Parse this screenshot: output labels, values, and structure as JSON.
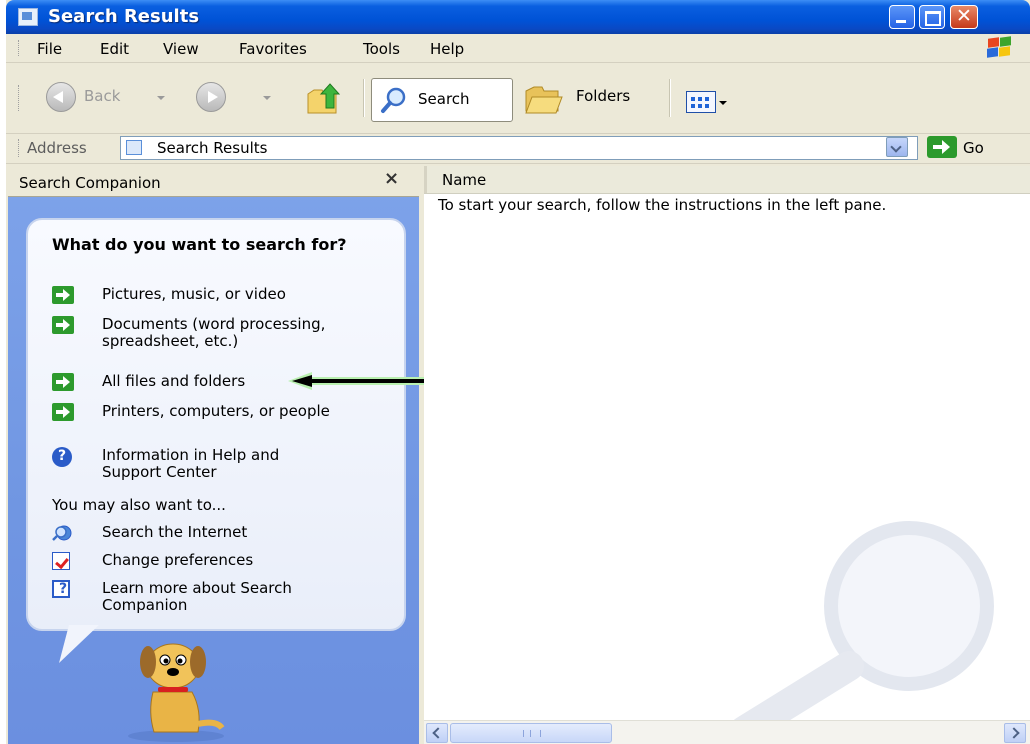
{
  "window": {
    "title": "Search Results"
  },
  "menu": [
    "File",
    "Edit",
    "View",
    "Favorites",
    "Tools",
    "Help"
  ],
  "toolbar": {
    "back_label": "Back",
    "search_label": "Search",
    "folders_label": "Folders"
  },
  "address": {
    "label": "Address",
    "value": "Search Results",
    "go_label": "Go"
  },
  "companion": {
    "header": "Search Companion",
    "close_glyph": "×",
    "question": "What do you want to search for?",
    "options": [
      "Pictures, music, or video",
      "Documents (word processing, spreadsheet, etc.)",
      "All files and folders",
      "Printers, computers, or people",
      "Information in Help and Support Center"
    ],
    "also_title": "You may also want to...",
    "also": [
      "Search the Internet",
      "Change preferences",
      "Learn more about Search Companion"
    ]
  },
  "results": {
    "column_name": "Name",
    "instruction": "To start your search, follow the instructions in the left pane."
  },
  "colors": {
    "title_blue": "#0052d6",
    "pane_blue": "#7096e2",
    "arrow_green": "#2d9a2d"
  }
}
